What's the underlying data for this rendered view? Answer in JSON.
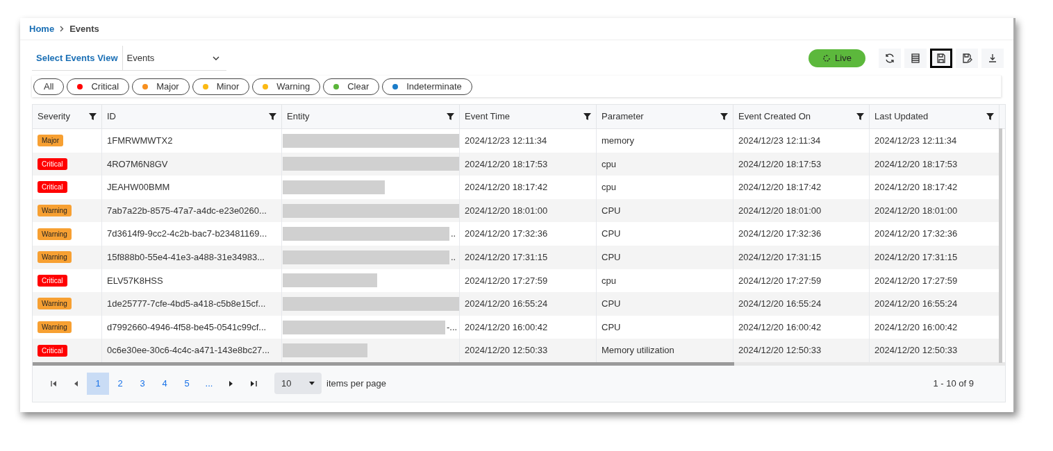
{
  "breadcrumb": [
    {
      "label": "Home",
      "kind": "link"
    },
    {
      "label": "Events",
      "kind": "current"
    }
  ],
  "view_selector": {
    "label": "Select Events View",
    "value": "Events"
  },
  "toolbar": {
    "live": "Live",
    "tools": [
      {
        "kind": "refresh",
        "highlighted": false
      },
      {
        "kind": "list",
        "highlighted": false
      },
      {
        "kind": "save",
        "highlighted": true
      },
      {
        "kind": "save-as",
        "highlighted": false
      },
      {
        "kind": "download",
        "highlighted": false
      }
    ]
  },
  "filters": [
    {
      "label": "All"
    },
    {
      "label": "Critical",
      "color": "#ff0000"
    },
    {
      "label": "Major",
      "color": "#f7901e"
    },
    {
      "label": "Minor",
      "color": "#fbb913"
    },
    {
      "label": "Warning",
      "color": "#fbb913"
    },
    {
      "label": "Clear",
      "color": "#5bb53a"
    },
    {
      "label": "Indeterminate",
      "color": "#1a7cc9"
    }
  ],
  "table": {
    "columns": [
      "Severity",
      "ID",
      "Entity",
      "Event Time",
      "Parameter",
      "Event Created On",
      "Last Updated"
    ],
    "rows": [
      {
        "severity": "Major",
        "kind": "major",
        "id": "1FMRWMWTX2",
        "event_time": "2024/12/23 12:11:34",
        "parameter": "memory",
        "created": "2024/12/23 12:11:34",
        "updated": "2024/12/23 12:11:34"
      },
      {
        "severity": "Critical",
        "kind": "critical",
        "id": "4RO7M6N8GV",
        "event_time": "2024/12/20 18:17:53",
        "parameter": "cpu",
        "created": "2024/12/20 18:17:53",
        "updated": "2024/12/20 18:17:53"
      },
      {
        "severity": "Critical",
        "kind": "critical",
        "id": "JEAHW00BMM",
        "event_time": "2024/12/20 18:17:42",
        "parameter": "cpu",
        "created": "2024/12/20 18:17:42",
        "updated": "2024/12/20 18:17:42"
      },
      {
        "severity": "Warning",
        "kind": "warning",
        "id": "7ab7a22b-8575-47a7-a4dc-e23e0260...",
        "event_time": "2024/12/20 18:01:00",
        "parameter": "CPU",
        "created": "2024/12/20 18:01:00",
        "updated": "2024/12/20 18:01:00"
      },
      {
        "severity": "Warning",
        "kind": "warning",
        "id": "7d3614f9-9cc2-4c2b-bac7-b23481169...",
        "entity": "..",
        "event_time": "2024/12/20 17:32:36",
        "parameter": "CPU",
        "created": "2024/12/20 17:32:36",
        "updated": "2024/12/20 17:32:36"
      },
      {
        "severity": "Warning",
        "kind": "warning",
        "id": "15f888b0-55e4-41e3-a488-31e34983...",
        "entity": "..",
        "event_time": "2024/12/20 17:31:15",
        "parameter": "CPU",
        "created": "2024/12/20 17:31:15",
        "updated": "2024/12/20 17:31:15"
      },
      {
        "severity": "Critical",
        "kind": "critical",
        "id": "ELV57K8HSS",
        "event_time": "2024/12/20 17:27:59",
        "parameter": "cpu",
        "created": "2024/12/20 17:27:59",
        "updated": "2024/12/20 17:27:59"
      },
      {
        "severity": "Warning",
        "kind": "warning",
        "id": "1de25777-7cfe-4bd5-a418-c5b8e15cf...",
        "event_time": "2024/12/20 16:55:24",
        "parameter": "CPU",
        "created": "2024/12/20 16:55:24",
        "updated": "2024/12/20 16:55:24"
      },
      {
        "severity": "Warning",
        "kind": "warning",
        "id": "d7992660-4946-4f58-be45-0541c99cf...",
        "entity": "-...",
        "event_time": "2024/12/20 16:00:42",
        "parameter": "CPU",
        "created": "2024/12/20 16:00:42",
        "updated": "2024/12/20 16:00:42"
      },
      {
        "severity": "Critical",
        "kind": "critical",
        "id": "0c6e30ee-30c6-4c4c-a471-143e8bc27...",
        "event_time": "2024/12/20 12:50:33",
        "parameter": "Memory utilization",
        "created": "2024/12/20 12:50:33",
        "updated": "2024/12/20 12:50:33"
      }
    ]
  },
  "pagination": {
    "pages": [
      {
        "label": "1",
        "selected": true
      },
      {
        "label": "2",
        "selected": false
      },
      {
        "label": "3",
        "selected": false
      },
      {
        "label": "4",
        "selected": false
      },
      {
        "label": "5",
        "selected": false
      },
      {
        "label": "...",
        "selected": false
      }
    ],
    "page_size": "10",
    "page_size_label": "items per page",
    "summary": "1 - 10 of 9"
  }
}
